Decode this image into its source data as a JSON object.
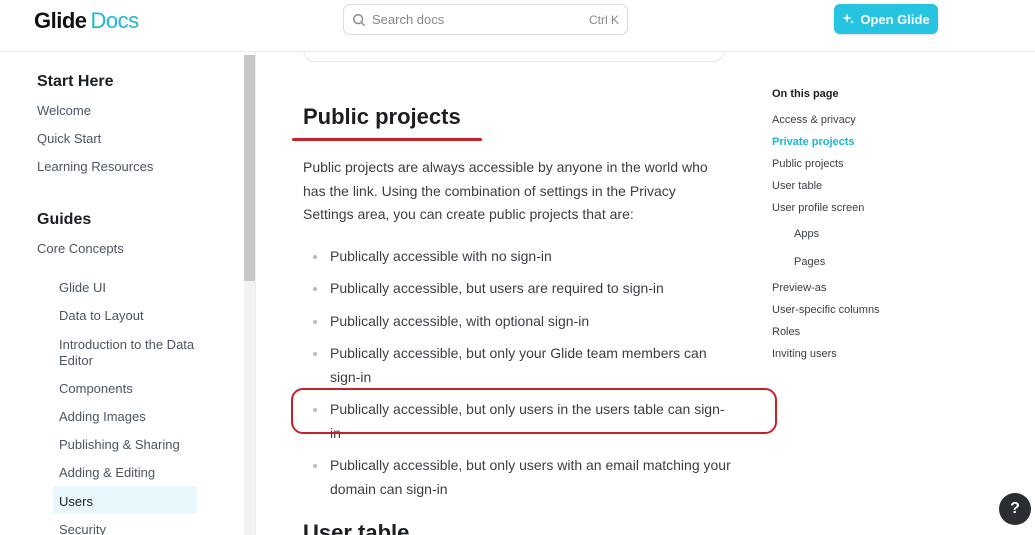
{
  "header": {
    "brand": "Glide",
    "product": "Docs",
    "search_placeholder": "Search docs",
    "search_shortcut": "Ctrl K",
    "open_button": "Open Glide"
  },
  "sidebar": {
    "sections": [
      {
        "heading": "Start Here",
        "items": [
          "Welcome",
          "Quick Start",
          "Learning Resources"
        ]
      },
      {
        "heading": "Guides",
        "items": [
          "Core Concepts"
        ]
      }
    ],
    "sub_items": [
      "Glide UI",
      "Data to Layout",
      "Introduction to the Data Editor",
      "Components",
      "Adding Images",
      "Publishing & Sharing",
      "Adding & Editing",
      "Users",
      "Security"
    ],
    "active_item": "Users"
  },
  "main": {
    "heading": "Public projects",
    "paragraph": "Public projects are always accessible by anyone in the world who has the link. Using the combination of settings in the Privacy Settings area, you can create public projects that are:",
    "bullets": [
      "Publically accessible with no sign-in",
      "Publically accessible, but users are required to sign-in",
      "Publically accessible, with optional sign-in",
      "Publically accessible, but only your Glide team members can sign-in",
      "Publically accessible, but only users in the users table can sign-in",
      "Publically accessible, but only users with an email matching your domain can sign-in"
    ],
    "next_heading": "User table"
  },
  "toc": {
    "title": "On this page",
    "items": [
      {
        "label": "Access & privacy",
        "level": 0
      },
      {
        "label": "Private projects",
        "level": 0,
        "active": true
      },
      {
        "label": "Public projects",
        "level": 0
      },
      {
        "label": "User table",
        "level": 0
      },
      {
        "label": "User profile screen",
        "level": 0
      },
      {
        "label": "Apps",
        "level": 1
      },
      {
        "label": "Pages",
        "level": 1
      },
      {
        "label": "Preview-as",
        "level": 0
      },
      {
        "label": "User-specific columns",
        "level": 0
      },
      {
        "label": "Roles",
        "level": 0
      },
      {
        "label": "Inviting users",
        "level": 0
      }
    ]
  },
  "help_button": "?",
  "colors": {
    "accent": "#1cb6d6",
    "button": "#26c4e0",
    "annotation_red": "#c8202a"
  }
}
